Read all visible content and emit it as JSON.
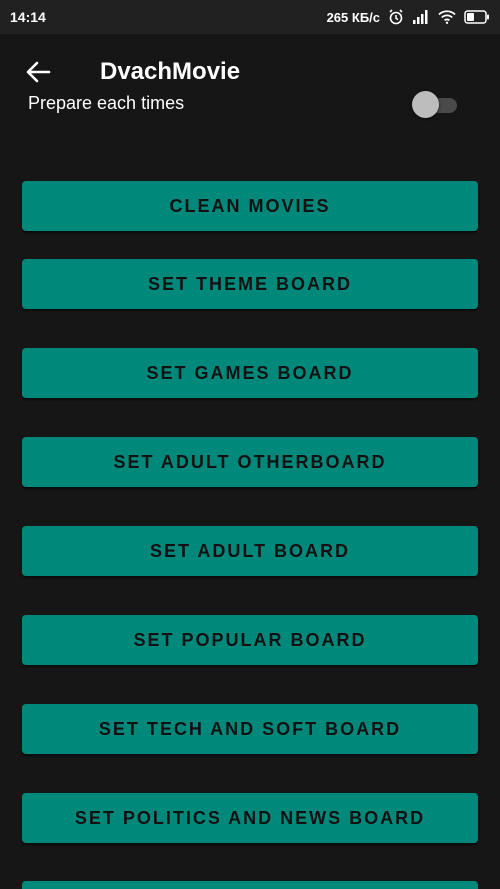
{
  "status_bar": {
    "time": "14:14",
    "speed": "265 КБ/с"
  },
  "header": {
    "title": "DvachMovie",
    "prepare_label": "Prepare each times",
    "prepare_toggle_on": false
  },
  "buttons": [
    {
      "label": "CLEAN MOVIES"
    },
    {
      "label": "SET THEME BOARD"
    },
    {
      "label": "SET GAMES BOARD"
    },
    {
      "label": "SET ADULT OTHERBOARD"
    },
    {
      "label": "SET ADULT BOARD"
    },
    {
      "label": "SET POPULAR BOARD"
    },
    {
      "label": "SET TECH AND SOFT BOARD"
    },
    {
      "label": "SET POLITICS AND NEWS BOARD"
    },
    {
      "label": ""
    }
  ],
  "colors": {
    "background": "#161616",
    "button": "#00897b",
    "button_text": "#111111"
  }
}
